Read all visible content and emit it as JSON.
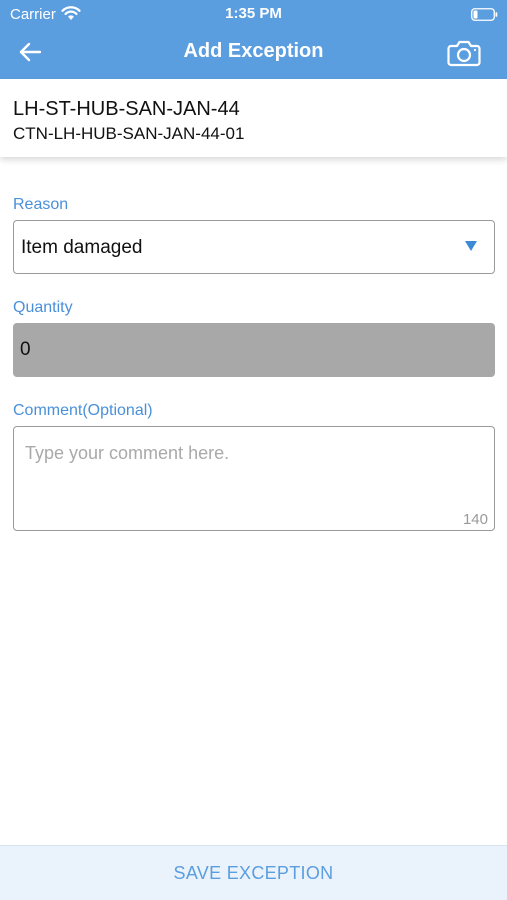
{
  "status_bar": {
    "carrier": "Carrier",
    "time": "1:35 PM",
    "wifi_icon": "wifi-icon",
    "battery_icon": "battery-icon"
  },
  "nav": {
    "title": "Add Exception",
    "back_icon": "back-arrow-icon",
    "camera_icon": "camera-icon"
  },
  "shipment": {
    "shipment_id": "LH-ST-HUB-SAN-JAN-44",
    "carton_id": "CTN-LH-HUB-SAN-JAN-44-01"
  },
  "form": {
    "reason_label": "Reason",
    "reason_value": "Item damaged",
    "quantity_label": "Quantity",
    "quantity_value": "0",
    "comment_label": "Comment(Optional)",
    "comment_placeholder": "Type your comment here.",
    "comment_char_count": "140"
  },
  "actions": {
    "save_label": "SAVE EXCEPTION"
  },
  "colors": {
    "header_bg": "#5b9ee0",
    "label_blue": "#4a90d9",
    "disabled_field": "#a8a8a8",
    "save_bar_bg": "#eaf2fb"
  }
}
